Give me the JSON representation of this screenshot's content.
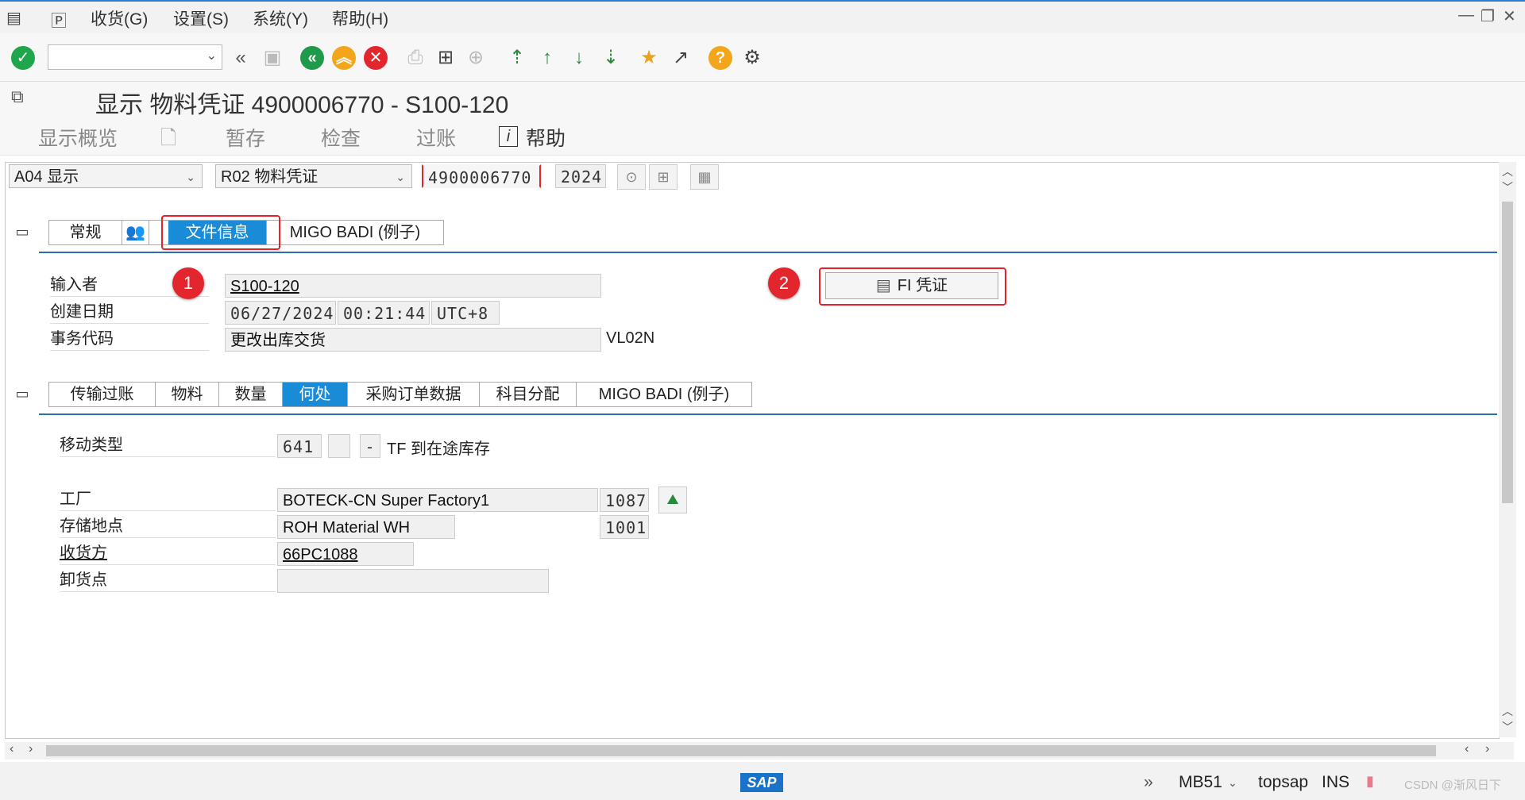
{
  "menu": {
    "receive": "收货(G)",
    "settings": "设置(S)",
    "system": "系统(Y)",
    "help": "帮助(H)"
  },
  "title": "显示 物料凭证 4900006770 - S100-120",
  "app_toolbar": {
    "overview": "显示概览",
    "hold": "暂存",
    "check": "检查",
    "post": "过账",
    "help": "帮助"
  },
  "header": {
    "action": "A04 显示",
    "ref": "R02 物料凭证",
    "doc_number": "4900006770",
    "year": "2024"
  },
  "header_tabs": [
    "常规",
    "文件信息",
    "MIGO BADI (例子)"
  ],
  "doc_info": {
    "entered_by_label": "输入者",
    "entered_by": "S100-120",
    "created_label": "创建日期",
    "created_date": "06/27/2024",
    "created_time": "00:21:44",
    "tz": "UTC+8",
    "tcode_label": "事务代码",
    "tcode_text": "更改出库交货",
    "tcode": "VL02N",
    "fi_button": "FI 凭证"
  },
  "item_tabs": [
    "传输过账",
    "物料",
    "数量",
    "何处",
    "采购订单数据",
    "科目分配",
    "MIGO BADI (例子)"
  ],
  "where": {
    "mvt_label": "移动类型",
    "mvt": "641",
    "mvt_sign": "-",
    "mvt_text": "TF 到在途库存",
    "plant_label": "工厂",
    "plant_name": "BOTECK-CN Super Factory1",
    "plant": "1087",
    "sloc_label": "存储地点",
    "sloc_name": "ROH Material WH",
    "sloc": "1001",
    "recipient_label": "收货方",
    "recipient": "66PC1088",
    "unload_label": "卸货点",
    "unload": ""
  },
  "annotations": {
    "badge1": "1",
    "badge2": "2"
  },
  "status": {
    "tcode": "MB51",
    "system": "topsap",
    "mode": "INS",
    "watermark": "CSDN @渐风日下"
  }
}
